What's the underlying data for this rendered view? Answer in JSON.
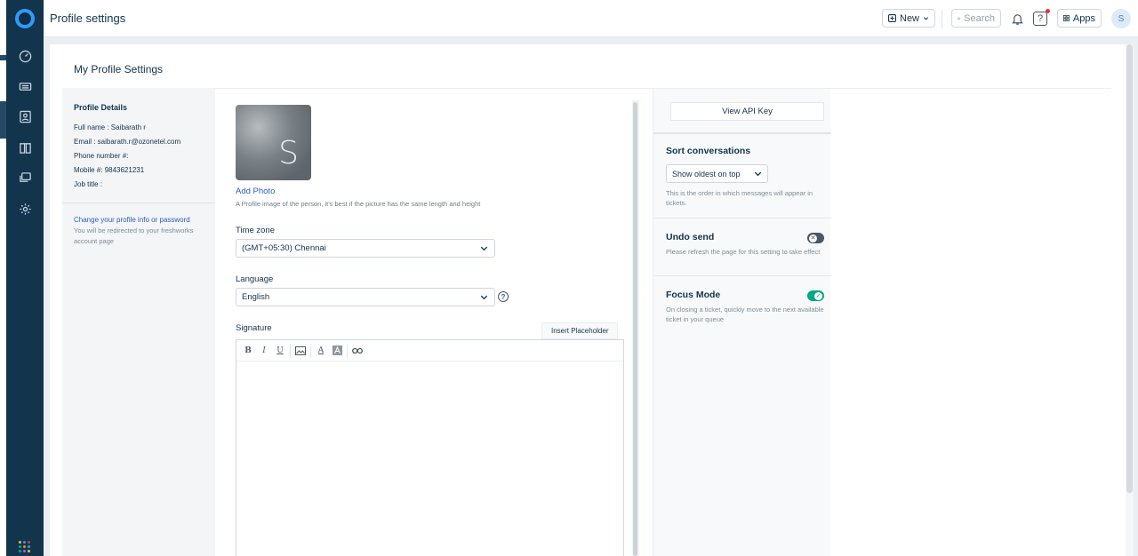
{
  "header": {
    "title": "Profile settings",
    "new_label": "New",
    "search_placeholder": "Search",
    "help_label": "?",
    "apps_label": "Apps",
    "avatar_initial": "S"
  },
  "page": {
    "title": "My Profile Settings"
  },
  "profile_details": {
    "heading": "Profile Details",
    "rows": [
      {
        "label": "Full name : ",
        "value": "Saibarath r"
      },
      {
        "label": "Email : ",
        "value": "saibarath.r@ozonetel.com"
      },
      {
        "label": "Phone number #:",
        "value": ""
      },
      {
        "label": "Mobile #: ",
        "value": "9843621231"
      },
      {
        "label": "Job title :",
        "value": ""
      }
    ],
    "change_link": "Change your profile info or password",
    "change_note": "You will be redirected to your freshworks account page"
  },
  "photo": {
    "initial": "S",
    "add_label": "Add Photo",
    "hint": "A Profile image of the person, it's best if the picture has the same length and height"
  },
  "timezone": {
    "label": "Time zone",
    "value": "(GMT+05:30) Chennai"
  },
  "language": {
    "label": "Language",
    "value": "English",
    "help": "?"
  },
  "signature": {
    "label": "Signature",
    "insert_placeholder": "Insert Placeholder",
    "toolbar": {
      "bold": "B",
      "italic": "I",
      "underline": "U",
      "font_color": "A"
    }
  },
  "right": {
    "api_key_button": "View API Key",
    "sort": {
      "heading": "Sort conversations",
      "value": "Show oldest on top",
      "note": "This is the order in which messages will appear in tickets."
    },
    "undo_send": {
      "heading": "Undo send",
      "enabled": false,
      "note": "Please refresh the page for this setting to take effect"
    },
    "focus_mode": {
      "heading": "Focus Mode",
      "enabled": true,
      "note": "On closing a ticket, quickly move to the next available ticket in your queue"
    }
  },
  "colors": {
    "sidebar": "#12344d",
    "brand": "#2c9cff",
    "link": "#2c5cc5",
    "toggle_on": "#00a886",
    "toggle_off": "#475867"
  },
  "icons": {
    "nav": [
      "dashboard-icon",
      "tickets-icon",
      "contacts-icon",
      "solutions-icon",
      "monitor-icon",
      "admin-gear-icon"
    ],
    "bottom": "apps-grid-icon"
  }
}
